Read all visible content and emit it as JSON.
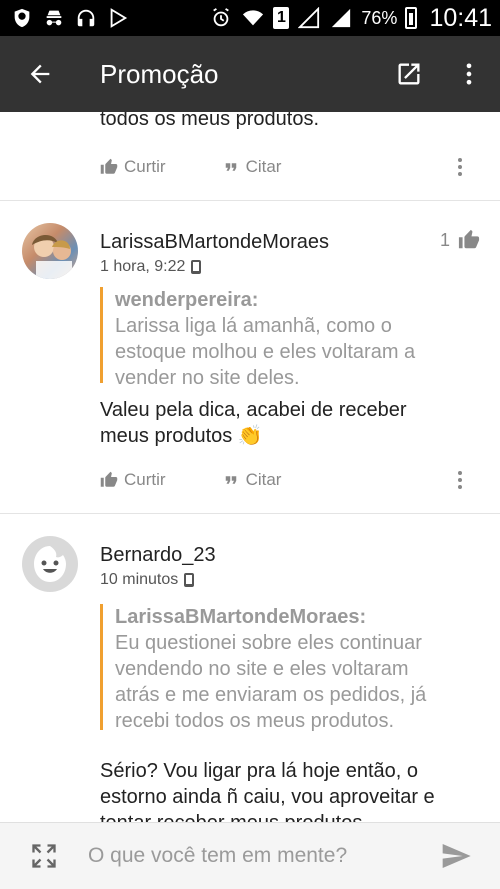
{
  "status_bar": {
    "icons": [
      "shield-icon",
      "incognito-icon",
      "headset-icon",
      "play-store-icon"
    ],
    "sim_label": "1",
    "battery": "76%",
    "time": "10:41"
  },
  "app_bar": {
    "title": "Promoção",
    "back_icon": "arrow-back-icon",
    "open_icon": "open-external-icon",
    "menu_icon": "more-vert-icon"
  },
  "posts": [
    {
      "partial_text": "todos os meus produtos.",
      "actions": {
        "like": "Curtir",
        "quote": "Citar"
      }
    },
    {
      "username": "LarissaBMartondeMoraes",
      "time": "1 hora, 9:22",
      "likes": "1",
      "quote": {
        "author": "wenderpereira:",
        "lines": [
          "Larissa liga lá amanhã, como o",
          "estoque molhou e eles voltaram a",
          "vender no site deles."
        ]
      },
      "body": [
        "Valeu pela dica, acabei de receber",
        "meus produtos 👏"
      ],
      "actions": {
        "like": "Curtir",
        "quote": "Citar"
      }
    },
    {
      "username": "Bernardo_23",
      "time": "10 minutos",
      "quote": {
        "author": "LarissaBMartondeMoraes:",
        "lines": [
          "Eu questionei sobre eles continuar",
          "vendendo no site e eles voltaram",
          "atrás e me enviaram os pedidos, já",
          "recebi todos os meus produtos."
        ]
      },
      "body": [
        "Sério? Vou ligar pra lá hoje então, o",
        "estorno ainda ñ caiu, vou aproveitar e",
        "tentar receber meus produtos"
      ]
    }
  ],
  "composer": {
    "placeholder": "O que você tem em mente?"
  }
}
